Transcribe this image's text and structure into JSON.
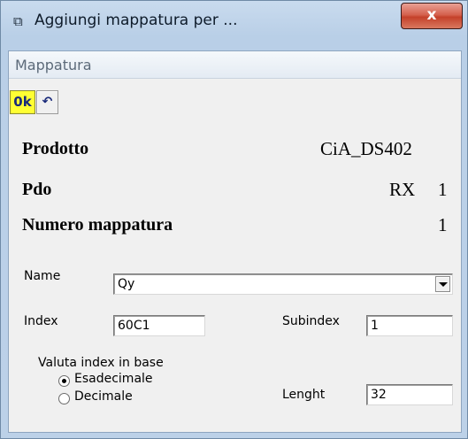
{
  "window": {
    "title": "Aggiungi mappatura per ...",
    "close_glyph": "x",
    "app_icon": "window-icon"
  },
  "menu": {
    "items": [
      "Mappatura"
    ]
  },
  "toolbar": {
    "ok_label": "0k",
    "undo_icon": "undo-icon",
    "ok_color": "#ffff33"
  },
  "info": {
    "prodotto_label": "Prodotto",
    "prodotto_value": "CiA_DS402",
    "pdo_label": "Pdo",
    "pdo_value_1": "RX",
    "pdo_value_2": "1",
    "numero_label": "Numero mappatura",
    "numero_value": "1"
  },
  "form": {
    "name_label": "Name",
    "name_value": "Qy",
    "index_label": "Index",
    "index_value": "60C1",
    "subindex_label": "Subindex",
    "subindex_value": "1",
    "base_label": "Valuta index in base",
    "radio_hex_label": "Esadecimale",
    "radio_dec_label": "Decimale",
    "radio_selected": "Esadecimale",
    "length_label": "Lenght",
    "length_value": "32"
  }
}
